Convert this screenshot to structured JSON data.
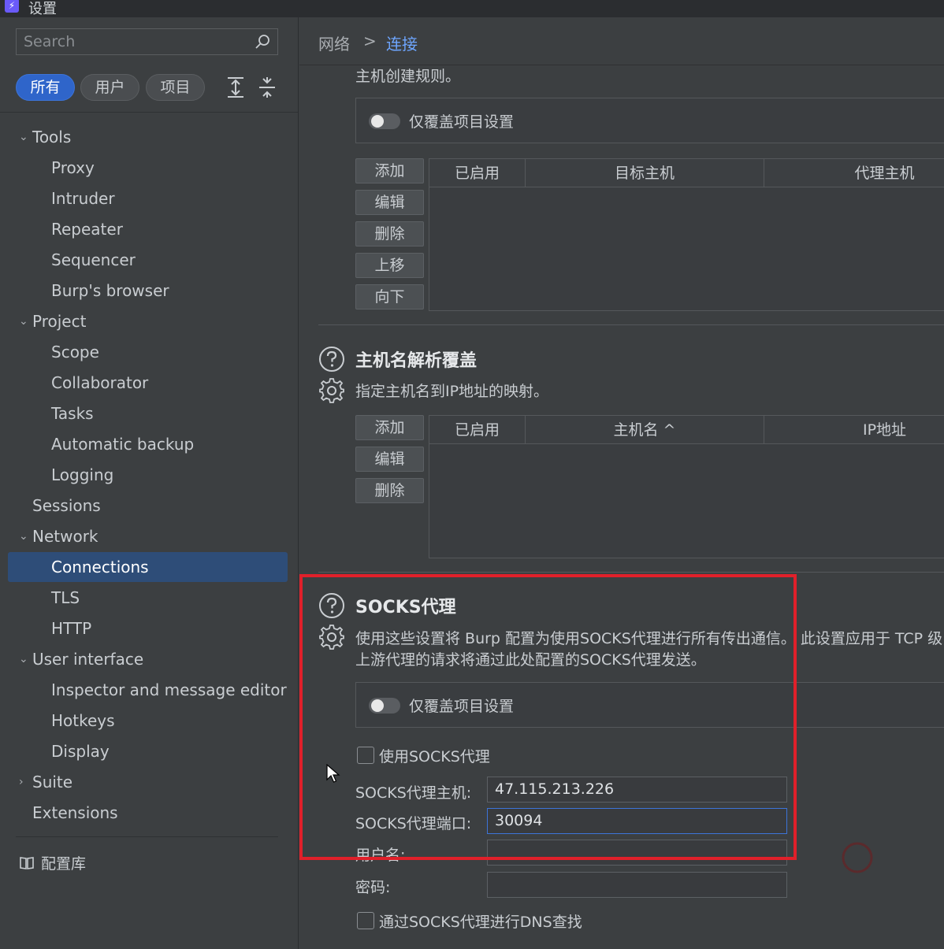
{
  "window": {
    "title": "设置"
  },
  "sidebar": {
    "search_placeholder": "Search",
    "filters": [
      "所有",
      "用户",
      "项目"
    ],
    "tree": [
      {
        "label": "Tools",
        "level": 0,
        "chevron": "expanded"
      },
      {
        "label": "Proxy",
        "level": 1
      },
      {
        "label": "Intruder",
        "level": 1
      },
      {
        "label": "Repeater",
        "level": 1
      },
      {
        "label": "Sequencer",
        "level": 1
      },
      {
        "label": "Burp's browser",
        "level": 1
      },
      {
        "label": "Project",
        "level": 0,
        "chevron": "expanded"
      },
      {
        "label": "Scope",
        "level": 1
      },
      {
        "label": "Collaborator",
        "level": 1
      },
      {
        "label": "Tasks",
        "level": 1
      },
      {
        "label": "Automatic backup",
        "level": 1
      },
      {
        "label": "Logging",
        "level": 1
      },
      {
        "label": "Sessions",
        "level": 0
      },
      {
        "label": "Network",
        "level": 0,
        "chevron": "expanded"
      },
      {
        "label": "Connections",
        "level": 1,
        "selected": true
      },
      {
        "label": "TLS",
        "level": 1
      },
      {
        "label": "HTTP",
        "level": 1
      },
      {
        "label": "User interface",
        "level": 0,
        "chevron": "expanded"
      },
      {
        "label": "Inspector and message editor",
        "level": 1
      },
      {
        "label": "Hotkeys",
        "level": 1
      },
      {
        "label": "Display",
        "level": 1
      },
      {
        "label": "Suite",
        "level": 0,
        "chevron": "collapsed"
      },
      {
        "label": "Extensions",
        "level": 0
      }
    ],
    "library_label": "配置库"
  },
  "breadcrumb": {
    "parent": "网络",
    "separator": ">",
    "current": "连接"
  },
  "upstream": {
    "desc_tail": "主机创建规则。",
    "override_label": "仅覆盖项目设置",
    "buttons": [
      "添加",
      "编辑",
      "删除",
      "上移",
      "向下"
    ],
    "columns": [
      "已启用",
      "目标主机",
      "代理主机"
    ]
  },
  "hostname_resolution": {
    "title": "主机名解析覆盖",
    "desc": "指定主机名到IP地址的映射。",
    "buttons": [
      "添加",
      "编辑",
      "删除"
    ],
    "columns": [
      "已启用",
      "主机名 ^",
      "IP地址"
    ]
  },
  "socks": {
    "title": "SOCKS代理",
    "desc_line1": "使用这些设置将 Burp 配置为使用SOCKS代理进行所有传出通信。 此设置应用于 TCP 级",
    "desc_line2": "上游代理的请求将通过此处配置的SOCKS代理发送。",
    "override_label": "仅覆盖项目设置",
    "use_socks_label": "使用SOCKS代理",
    "host_label": "SOCKS代理主机:",
    "host_value": "47.115.213.226",
    "port_label": "SOCKS代理端口:",
    "port_value": "30094",
    "username_label": "用户名:",
    "username_value": "",
    "password_label": "密码:",
    "password_value": "",
    "dns_label": "通过SOCKS代理进行DNS查找"
  },
  "colors": {
    "accent": "#2f65ca",
    "selected": "#2e4d78",
    "highlight_box": "#e0202a",
    "link": "#6ea6ff"
  }
}
